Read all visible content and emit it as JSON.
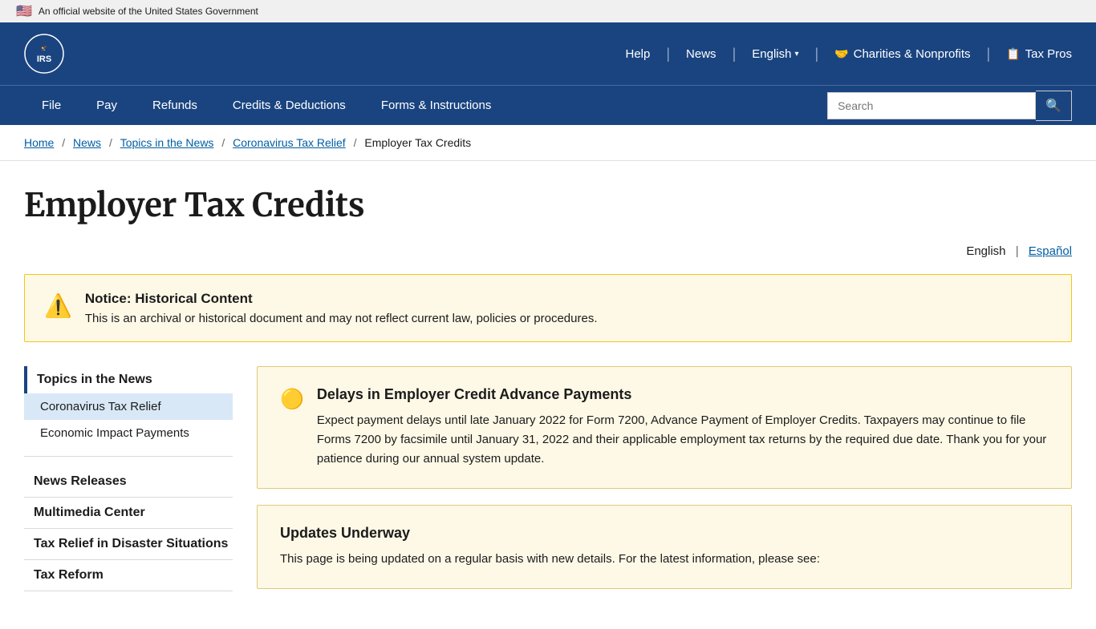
{
  "gov_banner": {
    "text": "An official website of the United States Government"
  },
  "header": {
    "logo_text": "IRS",
    "nav_items": [
      {
        "label": "Help",
        "id": "help"
      },
      {
        "label": "News",
        "id": "news"
      },
      {
        "label": "English",
        "id": "english"
      },
      {
        "label": "Charities & Nonprofits",
        "id": "charities"
      },
      {
        "label": "Tax Pros",
        "id": "taxpros"
      }
    ]
  },
  "main_nav": {
    "links": [
      {
        "label": "File",
        "id": "file"
      },
      {
        "label": "Pay",
        "id": "pay"
      },
      {
        "label": "Refunds",
        "id": "refunds"
      },
      {
        "label": "Credits & Deductions",
        "id": "credits"
      },
      {
        "label": "Forms & Instructions",
        "id": "forms"
      }
    ],
    "search_placeholder": "Search"
  },
  "breadcrumb": {
    "items": [
      {
        "label": "Home",
        "link": true
      },
      {
        "label": "News",
        "link": true
      },
      {
        "label": "Topics in the News",
        "link": true
      },
      {
        "label": "Coronavirus Tax Relief",
        "link": true
      },
      {
        "label": "Employer Tax Credits",
        "link": false
      }
    ]
  },
  "page": {
    "title": "Employer Tax Credits",
    "lang_current": "English",
    "lang_other": "Español",
    "lang_sep": "|"
  },
  "notice": {
    "title": "Notice: Historical Content",
    "text": "This is an archival or historical document and may not reflect current law, policies or procedures."
  },
  "sidebar": {
    "section_title": "Topics in the News",
    "items": [
      {
        "label": "Coronavirus Tax Relief",
        "active": true
      },
      {
        "label": "Economic Impact Payments",
        "active": false
      }
    ],
    "extra_links": [
      {
        "label": "News Releases"
      },
      {
        "label": "Multimedia Center"
      },
      {
        "label": "Tax Relief in Disaster Situations"
      },
      {
        "label": "Tax Reform"
      }
    ]
  },
  "content_cards": [
    {
      "id": "card1",
      "title": "Delays in Employer Credit Advance Payments",
      "text": "Expect payment delays until late January 2022 for Form 7200, Advance Payment of Employer Credits. Taxpayers may continue to file Forms 7200 by facsimile until January 31, 2022 and their applicable employment tax returns by the required due date. Thank you for your patience during our annual system update.",
      "icon": "warning"
    },
    {
      "id": "card2",
      "title": "Updates Underway",
      "text": "This page is being updated on a regular basis with new details. For the latest information, please see:",
      "icon": "none"
    }
  ]
}
